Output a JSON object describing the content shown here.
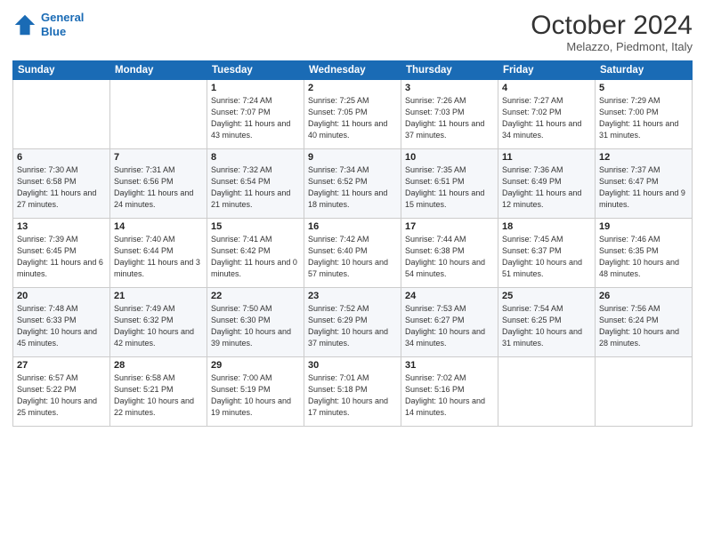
{
  "logo": {
    "line1": "General",
    "line2": "Blue"
  },
  "title": "October 2024",
  "location": "Melazzo, Piedmont, Italy",
  "weekdays": [
    "Sunday",
    "Monday",
    "Tuesday",
    "Wednesday",
    "Thursday",
    "Friday",
    "Saturday"
  ],
  "weeks": [
    [
      {
        "day": "",
        "sunrise": "",
        "sunset": "",
        "daylight": ""
      },
      {
        "day": "",
        "sunrise": "",
        "sunset": "",
        "daylight": ""
      },
      {
        "day": "1",
        "sunrise": "Sunrise: 7:24 AM",
        "sunset": "Sunset: 7:07 PM",
        "daylight": "Daylight: 11 hours and 43 minutes."
      },
      {
        "day": "2",
        "sunrise": "Sunrise: 7:25 AM",
        "sunset": "Sunset: 7:05 PM",
        "daylight": "Daylight: 11 hours and 40 minutes."
      },
      {
        "day": "3",
        "sunrise": "Sunrise: 7:26 AM",
        "sunset": "Sunset: 7:03 PM",
        "daylight": "Daylight: 11 hours and 37 minutes."
      },
      {
        "day": "4",
        "sunrise": "Sunrise: 7:27 AM",
        "sunset": "Sunset: 7:02 PM",
        "daylight": "Daylight: 11 hours and 34 minutes."
      },
      {
        "day": "5",
        "sunrise": "Sunrise: 7:29 AM",
        "sunset": "Sunset: 7:00 PM",
        "daylight": "Daylight: 11 hours and 31 minutes."
      }
    ],
    [
      {
        "day": "6",
        "sunrise": "Sunrise: 7:30 AM",
        "sunset": "Sunset: 6:58 PM",
        "daylight": "Daylight: 11 hours and 27 minutes."
      },
      {
        "day": "7",
        "sunrise": "Sunrise: 7:31 AM",
        "sunset": "Sunset: 6:56 PM",
        "daylight": "Daylight: 11 hours and 24 minutes."
      },
      {
        "day": "8",
        "sunrise": "Sunrise: 7:32 AM",
        "sunset": "Sunset: 6:54 PM",
        "daylight": "Daylight: 11 hours and 21 minutes."
      },
      {
        "day": "9",
        "sunrise": "Sunrise: 7:34 AM",
        "sunset": "Sunset: 6:52 PM",
        "daylight": "Daylight: 11 hours and 18 minutes."
      },
      {
        "day": "10",
        "sunrise": "Sunrise: 7:35 AM",
        "sunset": "Sunset: 6:51 PM",
        "daylight": "Daylight: 11 hours and 15 minutes."
      },
      {
        "day": "11",
        "sunrise": "Sunrise: 7:36 AM",
        "sunset": "Sunset: 6:49 PM",
        "daylight": "Daylight: 11 hours and 12 minutes."
      },
      {
        "day": "12",
        "sunrise": "Sunrise: 7:37 AM",
        "sunset": "Sunset: 6:47 PM",
        "daylight": "Daylight: 11 hours and 9 minutes."
      }
    ],
    [
      {
        "day": "13",
        "sunrise": "Sunrise: 7:39 AM",
        "sunset": "Sunset: 6:45 PM",
        "daylight": "Daylight: 11 hours and 6 minutes."
      },
      {
        "day": "14",
        "sunrise": "Sunrise: 7:40 AM",
        "sunset": "Sunset: 6:44 PM",
        "daylight": "Daylight: 11 hours and 3 minutes."
      },
      {
        "day": "15",
        "sunrise": "Sunrise: 7:41 AM",
        "sunset": "Sunset: 6:42 PM",
        "daylight": "Daylight: 11 hours and 0 minutes."
      },
      {
        "day": "16",
        "sunrise": "Sunrise: 7:42 AM",
        "sunset": "Sunset: 6:40 PM",
        "daylight": "Daylight: 10 hours and 57 minutes."
      },
      {
        "day": "17",
        "sunrise": "Sunrise: 7:44 AM",
        "sunset": "Sunset: 6:38 PM",
        "daylight": "Daylight: 10 hours and 54 minutes."
      },
      {
        "day": "18",
        "sunrise": "Sunrise: 7:45 AM",
        "sunset": "Sunset: 6:37 PM",
        "daylight": "Daylight: 10 hours and 51 minutes."
      },
      {
        "day": "19",
        "sunrise": "Sunrise: 7:46 AM",
        "sunset": "Sunset: 6:35 PM",
        "daylight": "Daylight: 10 hours and 48 minutes."
      }
    ],
    [
      {
        "day": "20",
        "sunrise": "Sunrise: 7:48 AM",
        "sunset": "Sunset: 6:33 PM",
        "daylight": "Daylight: 10 hours and 45 minutes."
      },
      {
        "day": "21",
        "sunrise": "Sunrise: 7:49 AM",
        "sunset": "Sunset: 6:32 PM",
        "daylight": "Daylight: 10 hours and 42 minutes."
      },
      {
        "day": "22",
        "sunrise": "Sunrise: 7:50 AM",
        "sunset": "Sunset: 6:30 PM",
        "daylight": "Daylight: 10 hours and 39 minutes."
      },
      {
        "day": "23",
        "sunrise": "Sunrise: 7:52 AM",
        "sunset": "Sunset: 6:29 PM",
        "daylight": "Daylight: 10 hours and 37 minutes."
      },
      {
        "day": "24",
        "sunrise": "Sunrise: 7:53 AM",
        "sunset": "Sunset: 6:27 PM",
        "daylight": "Daylight: 10 hours and 34 minutes."
      },
      {
        "day": "25",
        "sunrise": "Sunrise: 7:54 AM",
        "sunset": "Sunset: 6:25 PM",
        "daylight": "Daylight: 10 hours and 31 minutes."
      },
      {
        "day": "26",
        "sunrise": "Sunrise: 7:56 AM",
        "sunset": "Sunset: 6:24 PM",
        "daylight": "Daylight: 10 hours and 28 minutes."
      }
    ],
    [
      {
        "day": "27",
        "sunrise": "Sunrise: 6:57 AM",
        "sunset": "Sunset: 5:22 PM",
        "daylight": "Daylight: 10 hours and 25 minutes."
      },
      {
        "day": "28",
        "sunrise": "Sunrise: 6:58 AM",
        "sunset": "Sunset: 5:21 PM",
        "daylight": "Daylight: 10 hours and 22 minutes."
      },
      {
        "day": "29",
        "sunrise": "Sunrise: 7:00 AM",
        "sunset": "Sunset: 5:19 PM",
        "daylight": "Daylight: 10 hours and 19 minutes."
      },
      {
        "day": "30",
        "sunrise": "Sunrise: 7:01 AM",
        "sunset": "Sunset: 5:18 PM",
        "daylight": "Daylight: 10 hours and 17 minutes."
      },
      {
        "day": "31",
        "sunrise": "Sunrise: 7:02 AM",
        "sunset": "Sunset: 5:16 PM",
        "daylight": "Daylight: 10 hours and 14 minutes."
      },
      {
        "day": "",
        "sunrise": "",
        "sunset": "",
        "daylight": ""
      },
      {
        "day": "",
        "sunrise": "",
        "sunset": "",
        "daylight": ""
      }
    ]
  ]
}
